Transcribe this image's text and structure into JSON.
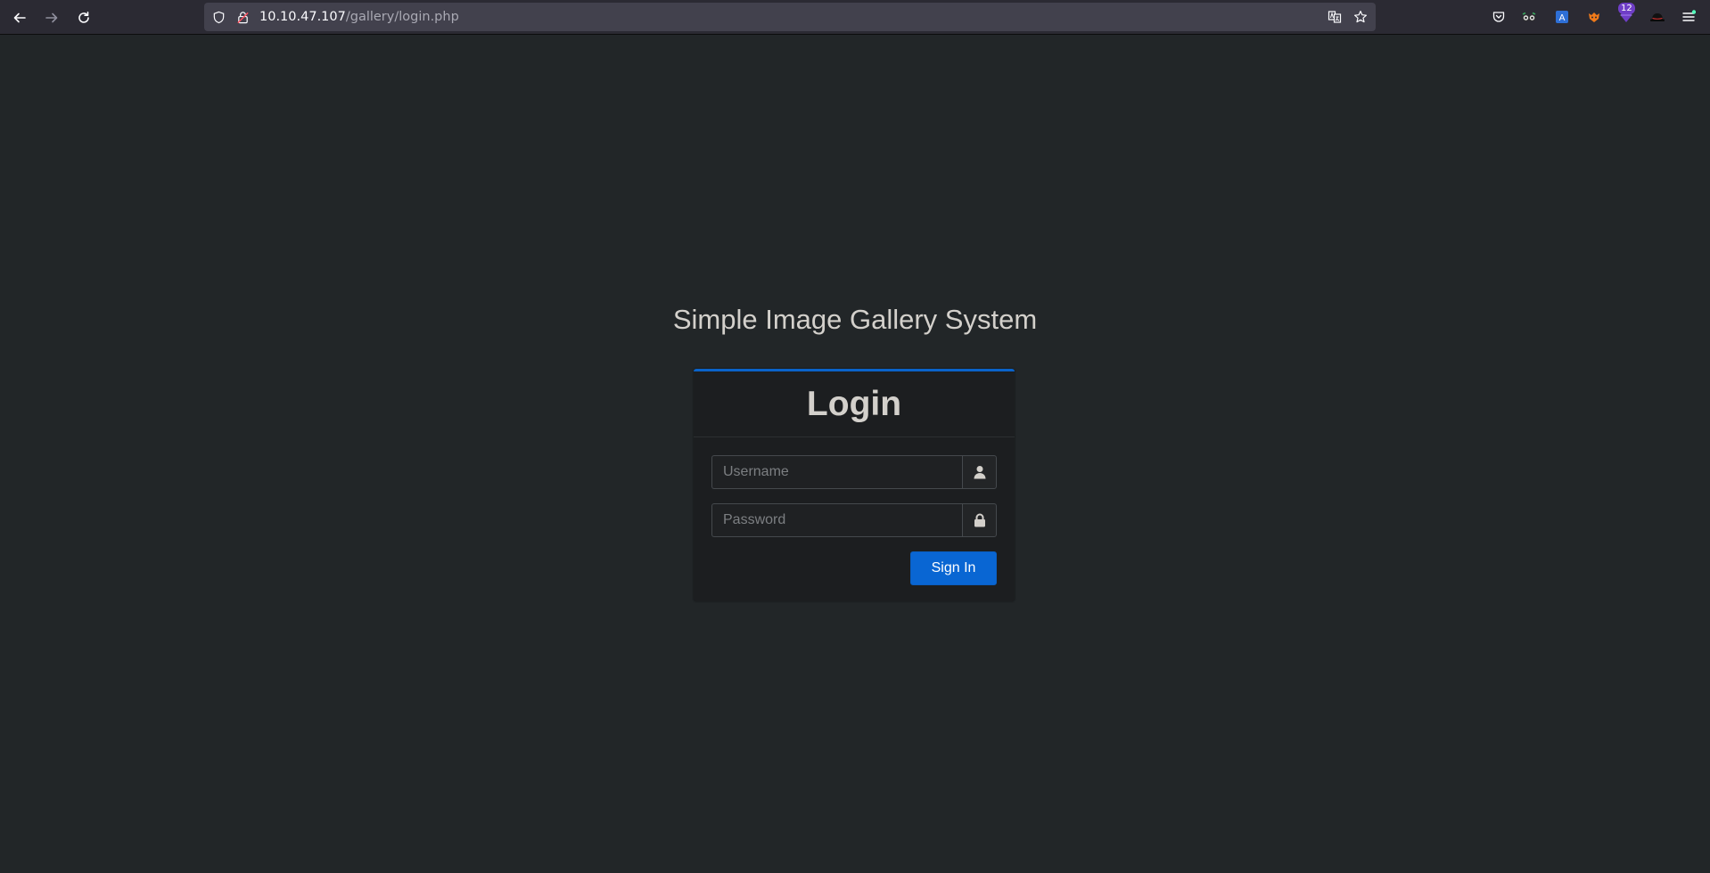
{
  "browser": {
    "url_host": "10.10.47.107",
    "url_path": "/gallery/login.php",
    "extension_badge": "12"
  },
  "page": {
    "title": "Simple Image Gallery System"
  },
  "login": {
    "heading": "Login",
    "username_placeholder": "Username",
    "password_placeholder": "Password",
    "submit_label": "Sign In"
  },
  "colors": {
    "page_bg": "#222628",
    "card_bg": "#1c1e20",
    "accent": "#0a63c9",
    "button": "#0966d3"
  }
}
